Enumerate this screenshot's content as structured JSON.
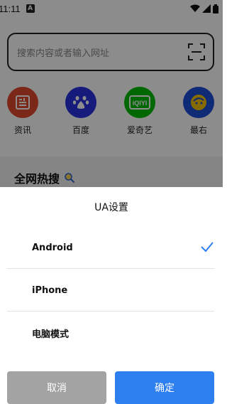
{
  "status_bar": {
    "time": "11:11",
    "notification_letter": "A"
  },
  "search": {
    "placeholder": "搜索内容或者输入网址"
  },
  "shortcuts": [
    {
      "label": "资讯",
      "icon": "news-icon",
      "color": "#e2492f"
    },
    {
      "label": "百度",
      "icon": "baidu-paw-icon",
      "color": "#2932e1"
    },
    {
      "label": "爱奇艺",
      "icon": "iqiyi-icon",
      "color": "#00be06"
    },
    {
      "label": "最右",
      "icon": "zuiyou-icon",
      "color": "#1e4fd6"
    }
  ],
  "hot_search": {
    "title": "全网热搜"
  },
  "ua_dialog": {
    "title": "UA设置",
    "options": [
      {
        "label": "Android",
        "selected": true
      },
      {
        "label": "iPhone",
        "selected": false
      },
      {
        "label": "电脑模式",
        "selected": false
      }
    ],
    "cancel_label": "取消",
    "confirm_label": "确定"
  },
  "colors": {
    "accent": "#2e7ff0",
    "cancel": "#a3a3a3"
  }
}
